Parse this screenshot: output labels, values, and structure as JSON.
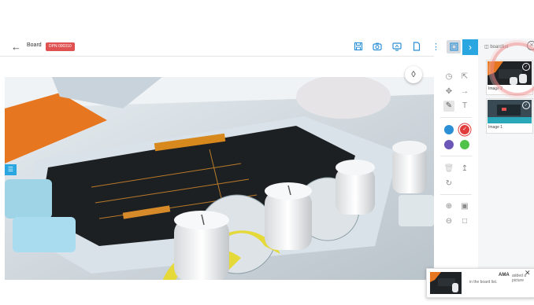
{
  "header": {
    "back_icon": "arrow-left-icon",
    "board_label": "Board",
    "badge": "DPN 000310"
  },
  "toolbar": {
    "icons": [
      "save-icon",
      "camera-icon",
      "screen-share-icon",
      "file-icon",
      "more-icon",
      "fullscreen-icon",
      "next-icon"
    ],
    "more_glyph": "⋮",
    "next_glyph": "›"
  },
  "side_tab_glyph": "☰",
  "tools": [
    "history-icon",
    "select-icon",
    "move-icon",
    "arrow-icon",
    "pen-icon",
    "text-icon",
    "trash-icon",
    "upload-icon",
    "rotate-icon",
    "zoom-in-icon",
    "zoom-fit-icon",
    "zoom-out-icon",
    "zoom-reset-icon"
  ],
  "colors": {
    "blue": "#2b8fd6",
    "red": "#e23b3b",
    "purple": "#6b57b8",
    "green": "#4fc24a",
    "accent": "#2aa7e0",
    "badge": "#e05252"
  },
  "board_list": {
    "title": "boardlist",
    "items": [
      {
        "caption": "Image 2"
      },
      {
        "caption": "Image 1"
      }
    ]
  },
  "toast": {
    "user": "AMA",
    "message_line1": "added a picture",
    "message_line2": "in the board list.",
    "close_glyph": "✕"
  }
}
